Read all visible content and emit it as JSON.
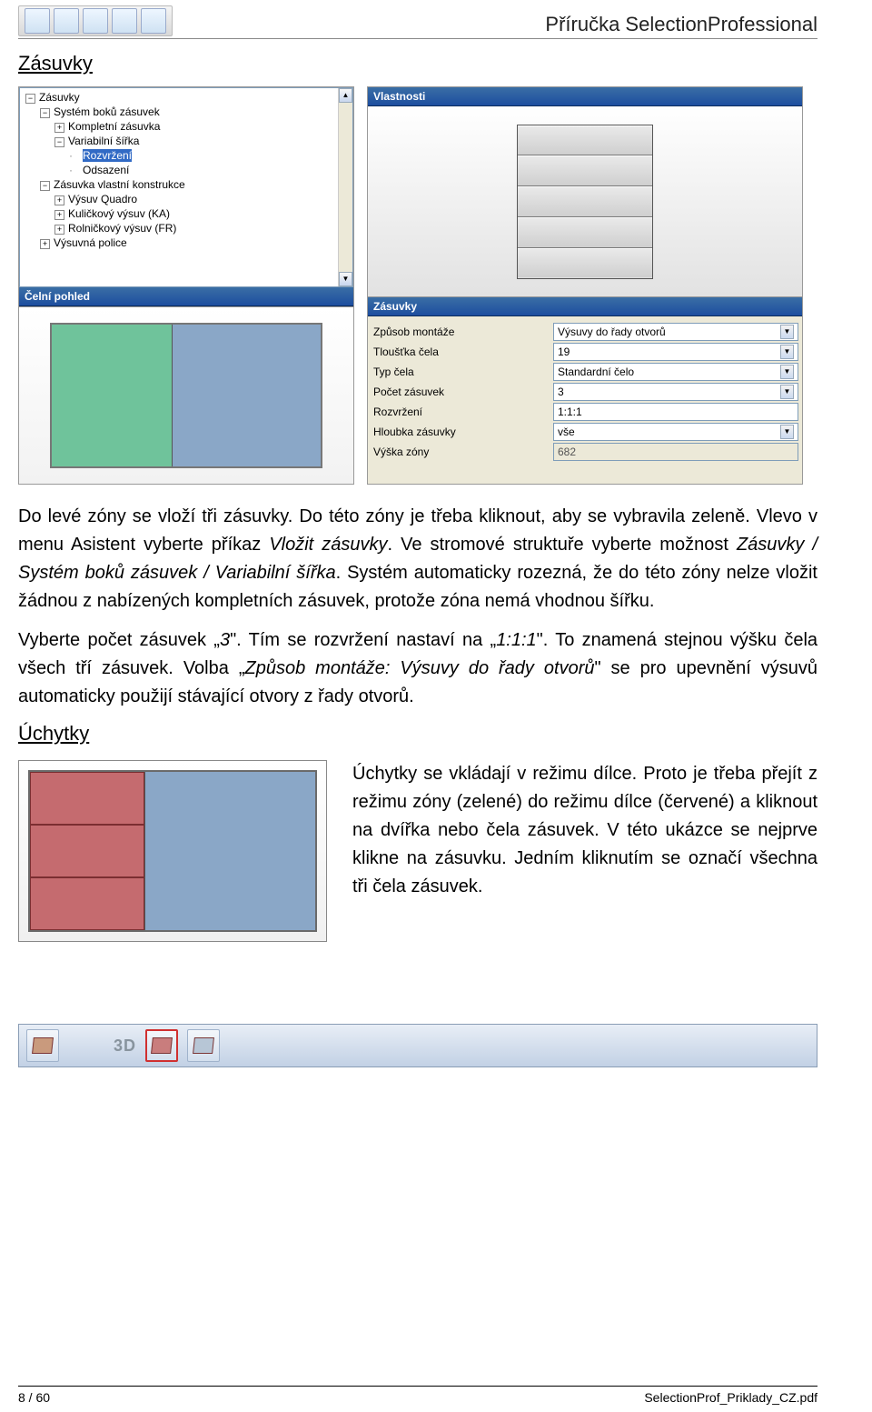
{
  "header": {
    "title": "Příručka SelectionProfessional"
  },
  "section1_title": "Zásuvky",
  "section2_title": "Úchytky",
  "tree": {
    "scroll_up": "▲",
    "scroll_down": "▼",
    "root": "Zásuvky",
    "n1": "Systém boků zásuvek",
    "n1a": "Kompletní zásuvka",
    "n1b": "Variabilní šířka",
    "n1b1": "Rozvržení",
    "n1b2": "Odsazení",
    "n2": "Zásuvka vlastní konstrukce",
    "n2a": "Výsuv Quadro",
    "n2b": "Kuličkový výsuv (KA)",
    "n2c": "Rolničkový výsuv (FR)",
    "n3": "Výsuvná police"
  },
  "frontview_title": "Čelní pohled",
  "prop_panel_title": "Vlastnosti",
  "props_title": "Zásuvky",
  "props": {
    "montaz_label": "Způsob montáže",
    "montaz_value": "Výsuvy do řady otvorů",
    "tloustka_label": "Tloušťka čela",
    "tloustka_value": "19",
    "typ_label": "Typ čela",
    "typ_value": "Standardní čelo",
    "pocet_label": "Počet zásuvek",
    "pocet_value": "3",
    "rozvr_label": "Rozvržení",
    "rozvr_value": "1:1:1",
    "hloubka_label": "Hloubka zásuvky",
    "hloubka_value": "vše",
    "vyska_label": "Výška zóny",
    "vyska_value": "682"
  },
  "para1_a": "Do levé zóny se vloží tři zásuvky. Do této zóny je třeba kliknout, aby se vybravila zeleně. Vlevo v menu Asistent vyberte příkaz ",
  "para1_i1": "Vložit zásuvky",
  "para1_b": ". Ve stromové struktuře vyberte možnost ",
  "para1_i2": "Zásuvky / Systém boků zásuvek / Variabilní šířka",
  "para1_c": ". Systém automaticky rozezná, že do této zóny nelze vložit žádnou z nabízených kompletních zásuvek, protože zóna nemá vhodnou šířku.",
  "para2_a": "Vyberte počet zásuvek „",
  "para2_i1": "3",
  "para2_b": "\". Tím se rozvržení nastaví na „",
  "para2_i2": "1:1:1",
  "para2_c": "\". To znamená stejnou výšku čela všech tří zásuvek. Volba „",
  "para2_i3": "Způsob montáže: Výsuvy do řady otvorů",
  "para2_d": "\" se pro upevnění výsuvů automaticky použijí stávající otvory z řady otvorů.",
  "para3": "Úchytky se vkládají v režimu dílce. Proto je třeba přejít z režimu zóny (zelené) do režimu dílce (červené) a kliknout na dvířka nebo čela zásuvek. V této ukázce se nejprve klikne na zásuvku. Jedním kliknutím se označí všechna tři čela zásuvek.",
  "toolbar_3d": "3D",
  "footer": {
    "page": "8 / 60",
    "file": "SelectionProf_Priklady_CZ.pdf"
  }
}
